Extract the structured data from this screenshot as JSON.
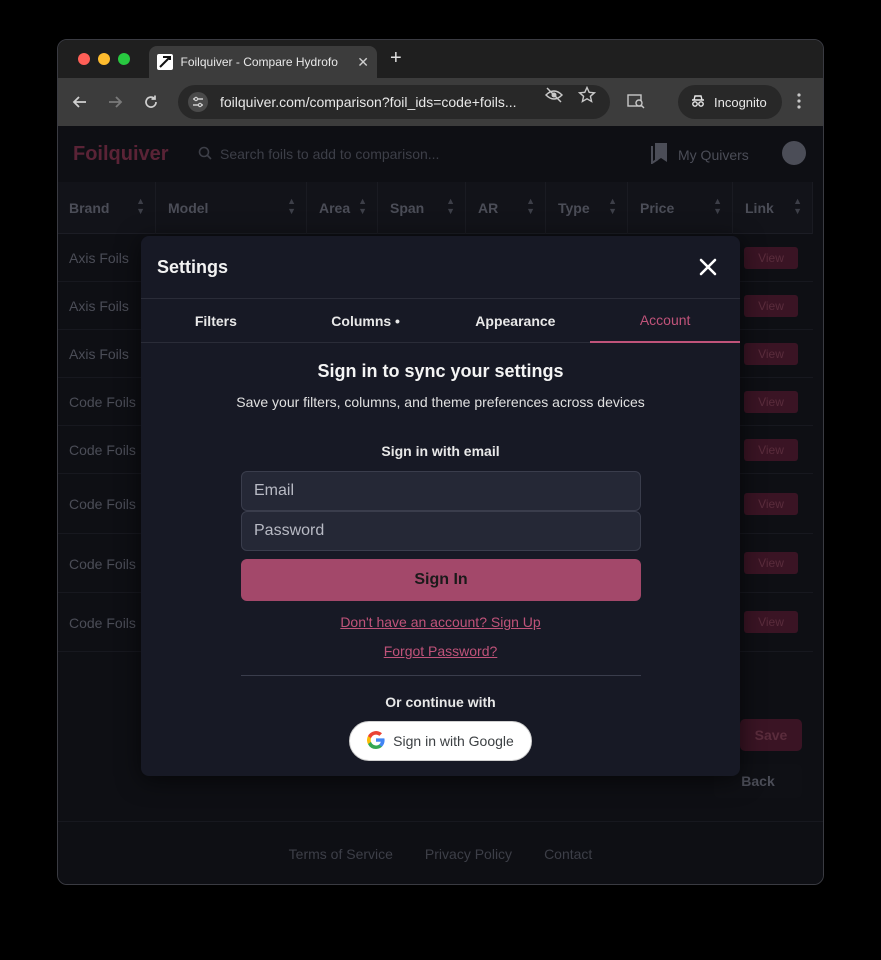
{
  "browser": {
    "tab_title": "Foilquiver - Compare Hydrofo",
    "url": "foilquiver.com/comparison?foil_ids=code+foils...",
    "incognito_label": "Incognito"
  },
  "app": {
    "logo": "Foilquiver",
    "search_placeholder": "Search foils to add to comparison...",
    "my_quivers": "My Quivers"
  },
  "table": {
    "headers": [
      "Brand",
      "Model",
      "Area",
      "Span",
      "AR",
      "Type",
      "Price",
      "Link"
    ],
    "rows": [
      {
        "brand": "Axis Foils",
        "link": "View"
      },
      {
        "brand": "Axis Foils",
        "link": "View"
      },
      {
        "brand": "Axis Foils",
        "link": "View"
      },
      {
        "brand": "Code Foils",
        "link": "View"
      },
      {
        "brand": "Code Foils",
        "link": "View"
      },
      {
        "brand": "Code Foils",
        "link": "View"
      },
      {
        "brand": "Code Foils",
        "link": "View"
      },
      {
        "brand": "Code Foils",
        "link": "View"
      }
    ]
  },
  "page_buttons": {
    "save": "Save",
    "back": "Back"
  },
  "footer": {
    "terms": "Terms of Service",
    "privacy": "Privacy Policy",
    "contact": "Contact"
  },
  "modal": {
    "title": "Settings",
    "tabs": [
      "Filters",
      "Columns •",
      "Appearance",
      "Account"
    ],
    "active_tab": "Account",
    "sync_title": "Sign in to sync your settings",
    "sync_subtitle": "Save your filters, columns, and theme preferences across devices",
    "email_section_label": "Sign in with email",
    "email_placeholder": "Email",
    "password_placeholder": "Password",
    "signin_label": "Sign In",
    "signup_link": "Don't have an account? Sign Up",
    "forgot_link": "Forgot Password?",
    "continue_label": "Or continue with",
    "google_label": "Sign in with Google"
  },
  "colors": {
    "accent": "#c0537a",
    "button": "#a3486a",
    "modal_bg": "#171925"
  }
}
